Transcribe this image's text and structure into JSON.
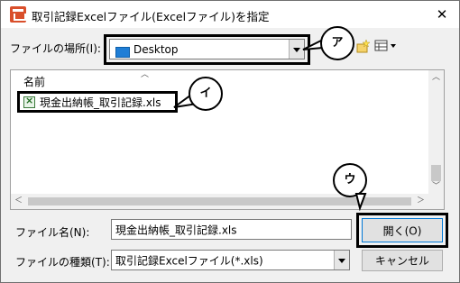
{
  "window": {
    "title": "取引記録Excelファイル(Excelファイル)を指定",
    "close_glyph": "✕"
  },
  "location": {
    "label": "ファイルの場所(I):",
    "value": "Desktop"
  },
  "file_list": {
    "column_header": "名前",
    "items": [
      {
        "name": "現金出納帳_取引記録.xls",
        "icon": "excel-file-icon"
      }
    ]
  },
  "file_name": {
    "label": "ファイル名(N):",
    "value": "現金出納帳_取引記録.xls"
  },
  "file_type": {
    "label": "ファイルの種類(T):",
    "value": "取引記録Excelファイル(*.xls)"
  },
  "buttons": {
    "open_label": "開く(O)",
    "cancel_label": "キャンセル"
  },
  "callouts": {
    "a": "ア",
    "i": "イ",
    "u": "ウ"
  },
  "icons": {
    "app": "app-icon",
    "desktop": "desktop-icon",
    "new_folder": "new-folder-icon",
    "view_menu": "view-menu-icon"
  },
  "colors": {
    "accent": "#0078d7",
    "desktop_blue": "#1f7ed6",
    "app_icon": "#d94f2b"
  }
}
